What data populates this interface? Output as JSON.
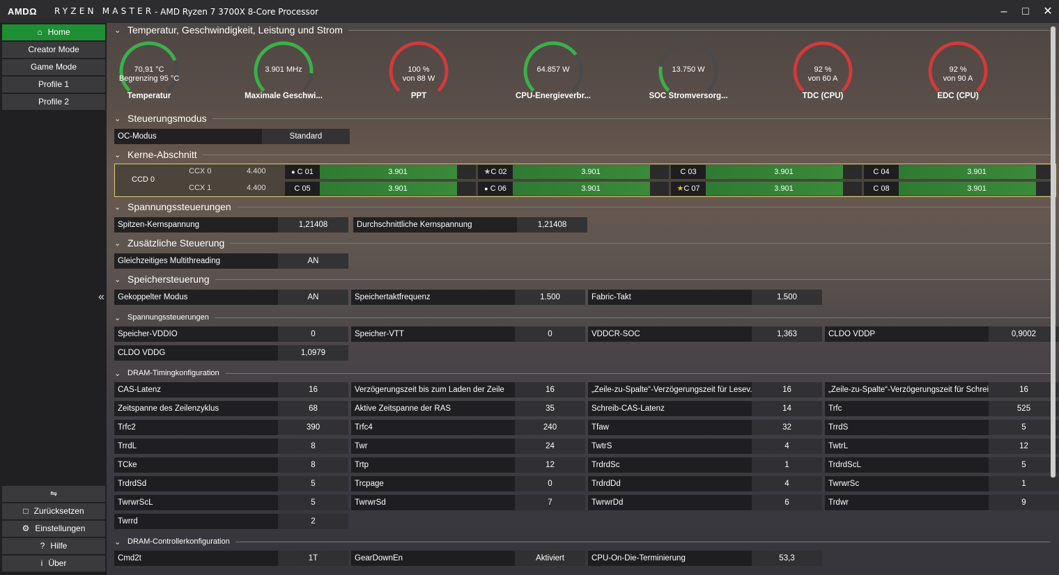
{
  "titlebar": {
    "brand": "AMDΩ",
    "product": "RYZEN MASTER",
    "title": "- AMD Ryzen 7 3700X 8-Core Processor",
    "controls": [
      "minimize-icon",
      "maximize-icon",
      "close-icon"
    ]
  },
  "sidebar": {
    "home": "Home",
    "creator": "Creator Mode",
    "game": "Game Mode",
    "profile1": "Profile 1",
    "profile2": "Profile 2",
    "reset": "Zurücksetzen",
    "settings": "Einstellungen",
    "help": "Hilfe",
    "about": "Über"
  },
  "sections": {
    "temp": "Temperatur, Geschwindigkeit, Leistung und Strom",
    "control": "Steuerungsmodus",
    "cores": "Kerne-Abschnitt",
    "voltage": "Spannungssteuerungen",
    "extra": "Zusätzliche Steuerung",
    "mem": "Speichersteuerung",
    "memvolt": "Spannungssteuerungen",
    "dram": "DRAM-Timingkonfiguration",
    "dramctrl": "DRAM-Controllerkonfiguration"
  },
  "gauges": [
    {
      "line1": "70,91 °C",
      "line2": "Begrenzing 95 °C",
      "label": "Temperatur",
      "color": "#3bb04a",
      "fraction": 0.75
    },
    {
      "line1": "3.901  MHz",
      "line2": "",
      "label": "Maximale Geschwi...",
      "color": "#3bb04a",
      "fraction": 0.85
    },
    {
      "line1": "100 %",
      "line2": "von 88 W",
      "label": "PPT",
      "color": "#d23a3a",
      "fraction": 1.0
    },
    {
      "line1": "64.857 W",
      "line2": "",
      "label": "CPU-Energieverbr...",
      "color": "#3bb04a",
      "fraction": 0.7
    },
    {
      "line1": "13.750 W",
      "line2": "",
      "label": "SOC Stromversorg...",
      "color": "#3bb04a",
      "fraction": 0.2
    },
    {
      "line1": "92 %",
      "line2": "von 60 A",
      "label": "TDC (CPU)",
      "color": "#d23a3a",
      "fraction": 1.0
    },
    {
      "line1": "92 %",
      "line2": "von 90 A",
      "label": "EDC (CPU)",
      "color": "#d23a3a",
      "fraction": 1.0
    }
  ],
  "oc": {
    "label": "OC-Modus",
    "value": "Standard"
  },
  "ccd": {
    "name": "CCD 0",
    "ccx0": "CCX 0",
    "ccx1": "CCX 1",
    "f0": "4.400",
    "f1": "4.400"
  },
  "cores": [
    {
      "name": "C 01",
      "value": "3.901",
      "mark": "dot",
      "fill": 0.88
    },
    {
      "name": "C 02",
      "value": "3.901",
      "mark": "star",
      "fill": 0.88
    },
    {
      "name": "C 03",
      "value": "3.901",
      "mark": "",
      "fill": 0.88
    },
    {
      "name": "C 04",
      "value": "3.901",
      "mark": "",
      "fill": 0.88
    },
    {
      "name": "C 05",
      "value": "3.901",
      "mark": "",
      "fill": 0.88
    },
    {
      "name": "C 06",
      "value": "3.901",
      "mark": "dot",
      "fill": 0.88
    },
    {
      "name": "C 07",
      "value": "3.901",
      "mark": "goldstar",
      "fill": 0.88
    },
    {
      "name": "C 08",
      "value": "3.901",
      "mark": "",
      "fill": 0.88
    }
  ],
  "voltage": [
    {
      "label": "Spitzen-Kernspannung",
      "value": "1,21408"
    },
    {
      "label": "Durchschnittliche Kernspannung",
      "value": "1,21408"
    }
  ],
  "extra": [
    {
      "label": "Gleichzeitiges Multithreading",
      "value": "AN"
    }
  ],
  "mem": [
    {
      "label": "Gekoppelter Modus",
      "value": "AN"
    },
    {
      "label": "Speichertaktfrequenz",
      "value": "1.500"
    },
    {
      "label": "Fabric-Takt",
      "value": "1.500"
    }
  ],
  "memvolt": [
    {
      "label": "Speicher-VDDIO",
      "value": "0"
    },
    {
      "label": "Speicher-VTT",
      "value": "0"
    },
    {
      "label": "VDDCR-SOC",
      "value": "1,363"
    },
    {
      "label": "CLDO VDDP",
      "value": "0,9002"
    },
    {
      "label": "CLDO VDDG",
      "value": "1,0979"
    }
  ],
  "dram": [
    {
      "label": "CAS-Latenz",
      "value": "16"
    },
    {
      "label": "Verzögerungszeit bis zum Laden der Zeile",
      "value": "16"
    },
    {
      "label": "„Zeile-zu-Spalte“-Verzögerungszeit für Lesev...",
      "value": "16"
    },
    {
      "label": "„Zeile-zu-Spalte“-Verzögerungszeit für Schrei...",
      "value": "16"
    },
    {
      "label": "Zeitspanne des Zeilenzyklus",
      "value": "68"
    },
    {
      "label": "Aktive Zeitspanne der RAS",
      "value": "35"
    },
    {
      "label": "Schreib-CAS-Latenz",
      "value": "14"
    },
    {
      "label": "Trfc",
      "value": "525"
    },
    {
      "label": "Trfc2",
      "value": "390"
    },
    {
      "label": "Trfc4",
      "value": "240"
    },
    {
      "label": "Tfaw",
      "value": "32"
    },
    {
      "label": "TrrdS",
      "value": "5"
    },
    {
      "label": "TrrdL",
      "value": "8"
    },
    {
      "label": "Twr",
      "value": "24"
    },
    {
      "label": "TwtrS",
      "value": "4"
    },
    {
      "label": "TwtrL",
      "value": "12"
    },
    {
      "label": "TCke",
      "value": "8"
    },
    {
      "label": "Trtp",
      "value": "12"
    },
    {
      "label": "TrdrdSc",
      "value": "1"
    },
    {
      "label": "TrdrdScL",
      "value": "5"
    },
    {
      "label": "TrdrdSd",
      "value": "5"
    },
    {
      "label": "Trcpage",
      "value": "0"
    },
    {
      "label": "TrdrdDd",
      "value": "4"
    },
    {
      "label": "TwrwrSc",
      "value": "1"
    },
    {
      "label": "TwrwrScL",
      "value": "5"
    },
    {
      "label": "TwrwrSd",
      "value": "7"
    },
    {
      "label": "TwrwrDd",
      "value": "6"
    },
    {
      "label": "Trdwr",
      "value": "9"
    },
    {
      "label": "Twrrd",
      "value": "2"
    }
  ],
  "dramctrl": [
    {
      "label": "Cmd2t",
      "value": "1T"
    },
    {
      "label": "GearDownEn",
      "value": "Aktiviert"
    },
    {
      "label": "CPU-On-Die-Terminierung",
      "value": "53,3"
    }
  ]
}
